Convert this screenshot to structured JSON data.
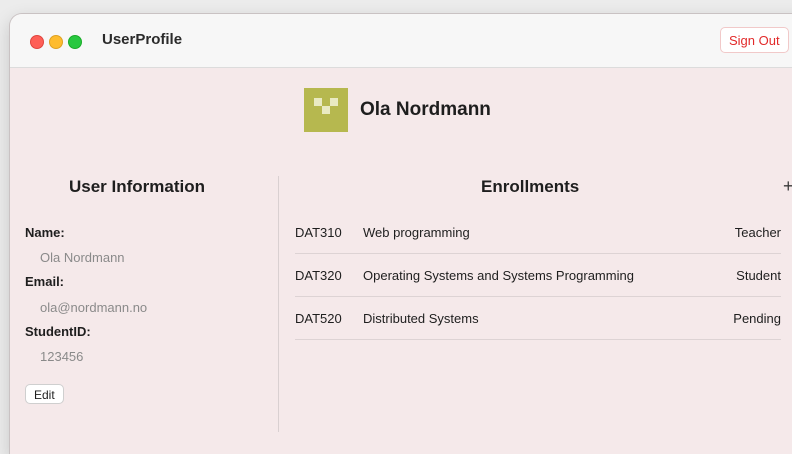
{
  "window": {
    "title": "UserProfile",
    "sign_out_label": "Sign Out"
  },
  "profile": {
    "name": "Ola Nordmann",
    "avatar_icon": "identicon"
  },
  "user_info": {
    "heading": "User Information",
    "name_label": "Name:",
    "name_value": "Ola Nordmann",
    "email_label": "Email:",
    "email_value": "ola@nordmann.no",
    "student_id_label": "StudentID:",
    "student_id_value": "123456",
    "edit_label": "Edit"
  },
  "enrollments": {
    "heading": "Enrollments",
    "add_icon": "plus-icon",
    "rows": [
      {
        "code": "DAT310",
        "course": "Web programming",
        "status": "Teacher"
      },
      {
        "code": "DAT320",
        "course": "Operating Systems and Systems Programming",
        "status": "Student"
      },
      {
        "code": "DAT520",
        "course": "Distributed Systems",
        "status": "Pending"
      }
    ]
  },
  "colors": {
    "background": "#f5e9ea",
    "sign_out": "#e22a2a",
    "avatar": "#b6b84f"
  }
}
